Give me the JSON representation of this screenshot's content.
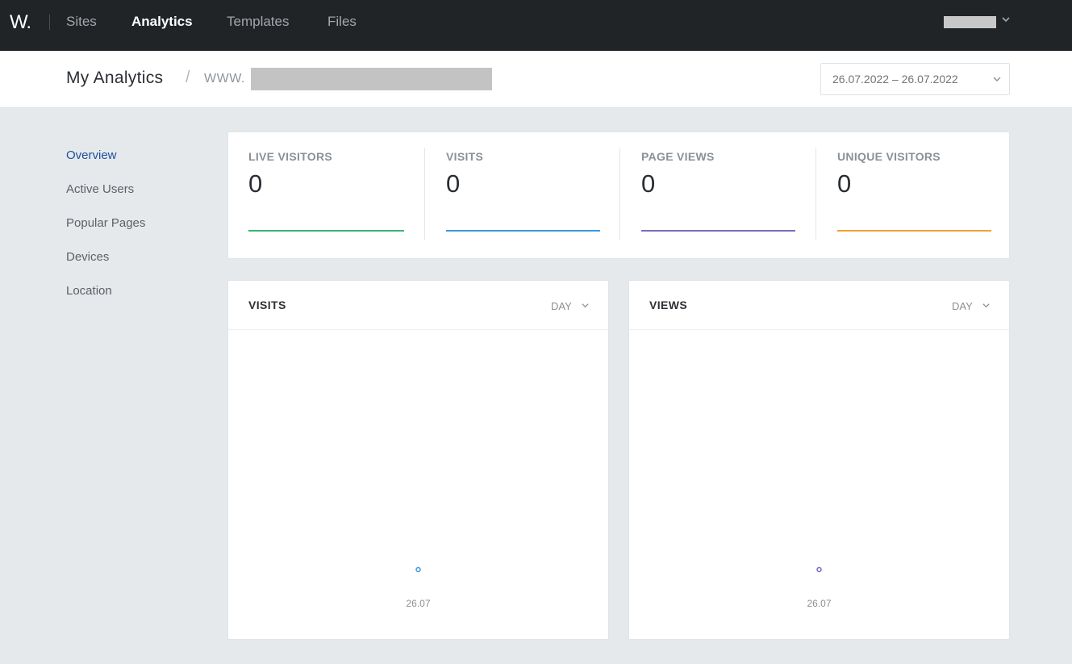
{
  "nav": {
    "logo": "W.",
    "items": [
      "Sites",
      "Analytics",
      "Templates",
      "Files"
    ],
    "active": "Analytics"
  },
  "header": {
    "title": "My Analytics",
    "separator": "/",
    "site_prefix": "WWW.",
    "date_range": "26.07.2022  –  26.07.2022"
  },
  "sidebar": {
    "items": [
      "Overview",
      "Active Users",
      "Popular Pages",
      "Devices",
      "Location"
    ],
    "active": "Overview"
  },
  "stats": [
    {
      "label": "LIVE VISITORS",
      "value": "0",
      "color": "#3cb371"
    },
    {
      "label": "VISITS",
      "value": "0",
      "color": "#3f9ae0"
    },
    {
      "label": "PAGE VIEWS",
      "value": "0",
      "color": "#7b6bbd"
    },
    {
      "label": "UNIQUE VISITORS",
      "value": "0",
      "color": "#f0a135"
    }
  ],
  "charts": {
    "visits": {
      "title": "VISITS",
      "period": "DAY",
      "color": "#3f9ae0"
    },
    "views": {
      "title": "VIEWS",
      "period": "DAY",
      "color": "#7b6bbd"
    }
  },
  "chart_data": [
    {
      "type": "line",
      "title": "VISITS",
      "x": [
        "26.07"
      ],
      "series": [
        {
          "values": [
            0
          ]
        }
      ]
    },
    {
      "type": "line",
      "title": "VIEWS",
      "x": [
        "26.07"
      ],
      "series": [
        {
          "values": [
            0
          ]
        }
      ]
    }
  ],
  "icons": {
    "user_menu": "chevron-down-icon",
    "date_picker": "chevron-down-icon",
    "period": "chevron-down-icon"
  }
}
